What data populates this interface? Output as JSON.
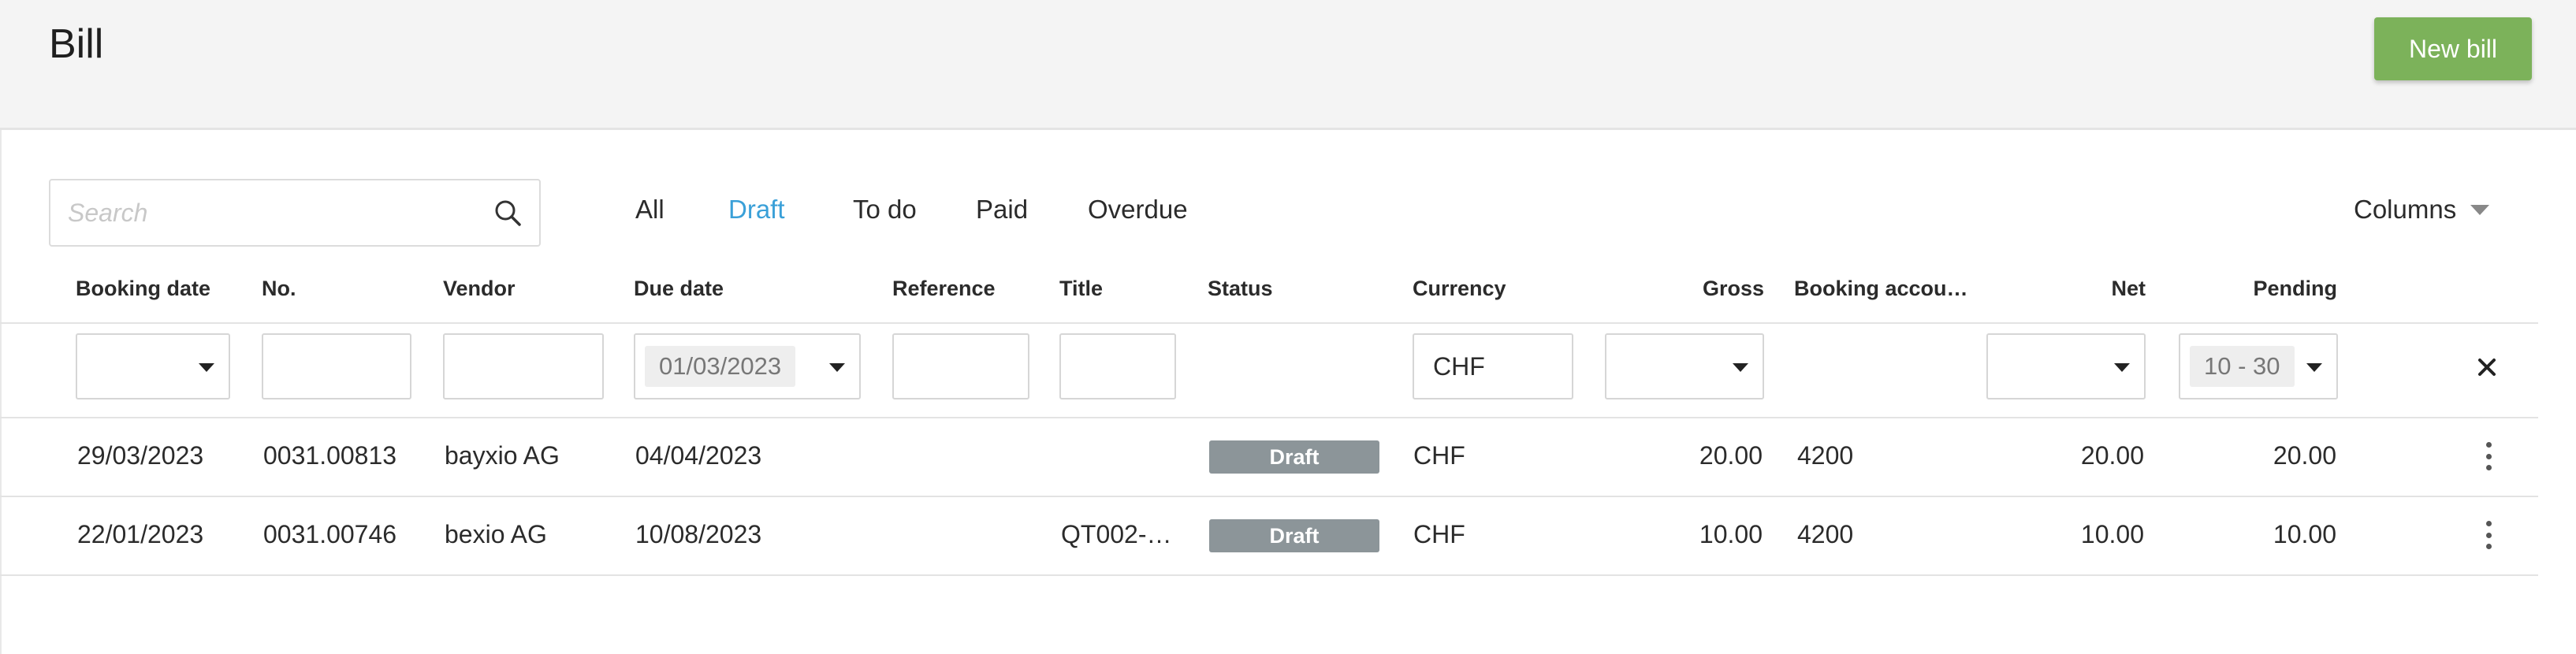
{
  "header": {
    "title": "Bill",
    "new_bill_label": "New bill"
  },
  "search": {
    "placeholder": "Search",
    "value": ""
  },
  "filter_tabs": [
    {
      "label": "All",
      "active": false
    },
    {
      "label": "Draft",
      "active": true
    },
    {
      "label": "To do",
      "active": false
    },
    {
      "label": "Paid",
      "active": false
    },
    {
      "label": "Overdue",
      "active": false
    }
  ],
  "columns_label": "Columns",
  "table": {
    "headers": {
      "booking_date": "Booking date",
      "no": "No.",
      "vendor": "Vendor",
      "due_date": "Due date",
      "reference": "Reference",
      "title": "Title",
      "status": "Status",
      "currency": "Currency",
      "gross": "Gross",
      "booking_account": "Booking accou…",
      "net": "Net",
      "pending": "Pending"
    },
    "filters": {
      "due_date": "01/03/2023",
      "currency": "CHF",
      "pending": "10 - 30"
    },
    "rows": [
      {
        "booking_date": "29/03/2023",
        "no": "0031.00813",
        "vendor": "bayxio AG",
        "due_date": "04/04/2023",
        "reference": "",
        "title": "",
        "status": "Draft",
        "currency": "CHF",
        "gross": "20.00",
        "booking_account": "4200",
        "net": "20.00",
        "pending": "20.00"
      },
      {
        "booking_date": "22/01/2023",
        "no": "0031.00746",
        "vendor": "bexio AG",
        "due_date": "10/08/2023",
        "reference": "",
        "title": "QT002-…",
        "status": "Draft",
        "currency": "CHF",
        "gross": "10.00",
        "booking_account": "4200",
        "net": "10.00",
        "pending": "10.00"
      }
    ]
  },
  "colors": {
    "primary_button": "#7cb25a",
    "active_tab": "#3aa0d8",
    "status_draft": "#8c9599"
  }
}
